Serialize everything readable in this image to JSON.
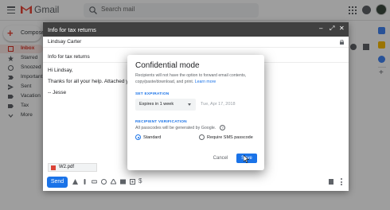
{
  "app": {
    "name": "Gmail"
  },
  "search": {
    "placeholder": "Search mail"
  },
  "sidebar": {
    "compose_label": "Compose",
    "items": [
      {
        "label": "Inbox",
        "icon": "inbox-icon",
        "active": true
      },
      {
        "label": "Starred",
        "icon": "star-icon"
      },
      {
        "label": "Snoozed",
        "icon": "clock-icon"
      },
      {
        "label": "Important",
        "icon": "important-icon"
      },
      {
        "label": "Sent",
        "icon": "send-icon"
      },
      {
        "label": "Vacation",
        "icon": "label-icon"
      },
      {
        "label": "Tax",
        "icon": "label-icon"
      },
      {
        "label": "More",
        "icon": "chevron-down-icon"
      }
    ]
  },
  "compose": {
    "title": "Info for tax returns",
    "to": "Lindsay Carter",
    "subject": "Info for tax returns",
    "body_lines": [
      "Hi Lindsay,",
      "Thanks for all your help. Attached you'll fi",
      "-- Jesse"
    ],
    "attachment": "W2.pdf",
    "send_label": "Send",
    "toolbar_icons": [
      "format-icon",
      "attach-icon",
      "link-icon",
      "emoji-icon",
      "drive-icon",
      "photo-icon",
      "confidential-icon",
      "signature-icon"
    ]
  },
  "modal": {
    "title": "Confidential mode",
    "description": "Recipients will not have the option to forward email contents, copy/paste/download, and print.",
    "learn_more": "Learn more",
    "set_expiration_label": "SET EXPIRATION",
    "expiration_value": "Expires in 1 week",
    "expiration_date": "Tue, Apr 17, 2018",
    "recipient_verification_label": "RECIPIENT VERIFICATION",
    "passcode_note": "All passcodes will be generated by Google.",
    "radio_standard": "Standard",
    "radio_sms": "Require SMS passcode",
    "selected_option": "Standard",
    "cancel_label": "Cancel",
    "save_label": "Save"
  },
  "colors": {
    "accent": "#1a73e8",
    "gmail_red": "#ea4335",
    "compose_header": "#404040",
    "active_nav_bg": "#fce8e6"
  }
}
